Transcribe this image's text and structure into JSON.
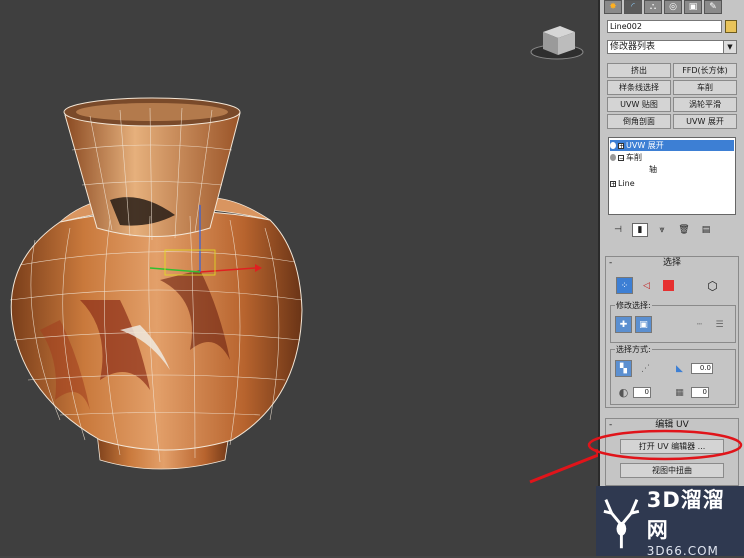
{
  "command_panel": {
    "tabs": [
      {
        "icon": "create-icon",
        "glyph": "✸"
      },
      {
        "icon": "modify-icon",
        "glyph": "◜"
      },
      {
        "icon": "hierarchy-icon",
        "glyph": "⛬"
      },
      {
        "icon": "motion-icon",
        "glyph": "◎"
      },
      {
        "icon": "display-icon",
        "glyph": "▣"
      },
      {
        "icon": "utilities-icon",
        "glyph": "✎"
      }
    ],
    "object_name": "Line002",
    "object_color": "#e8c35a",
    "modifier_list": "修改器列表",
    "modifier_buttons": [
      "挤出",
      "FFD(长方体)",
      "样条线选择",
      "车削",
      "UVW 贴图",
      "涡轮平滑",
      "倒角剖面",
      "UVW 展开"
    ],
    "stack": [
      {
        "label": "UVW 展开",
        "selected": true
      },
      {
        "label": "车削",
        "selected": false
      },
      {
        "label": "轴",
        "selected": false
      },
      {
        "label": "Line",
        "selected": false
      }
    ]
  },
  "select_rollout": {
    "title": "选择",
    "modify_selection_label": "修改选择:",
    "select_by_label": "选择方式:",
    "angle_value": "0.0",
    "spinner_a": "0",
    "spinner_b": "0"
  },
  "edit_uv_rollout": {
    "title": "编辑 UV",
    "open_editor_button": "打开 UV 编辑器 ...",
    "tweak_in_view_button": "视图中扭曲"
  },
  "watermark": {
    "brand": "3D溜溜网",
    "url": "3D66.COM"
  },
  "colors": {
    "highlight_annotation": "#e0141a",
    "selection_blue": "#3d7fd4",
    "viewport_bg": "#3f3f3f"
  }
}
